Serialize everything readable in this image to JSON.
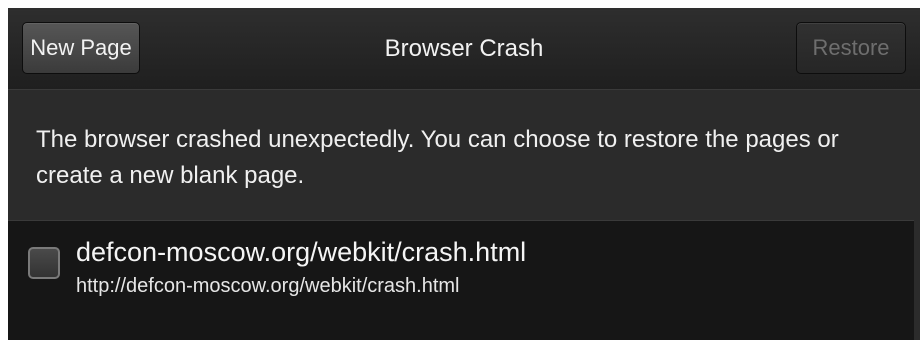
{
  "titlebar": {
    "title": "Browser Crash",
    "new_page_label": "New Page",
    "restore_label": "Restore",
    "restore_enabled": false
  },
  "message": "The browser crashed unexpectedly. You can choose to restore the pages or create a new blank page.",
  "pages": [
    {
      "title": "defcon-moscow.org/webkit/crash.html",
      "url": "http://defcon-moscow.org/webkit/crash.html",
      "checked": false
    }
  ],
  "colors": {
    "background": "#2b2b2b",
    "list_background": "#161616",
    "text": "#f0f0f0",
    "disabled_text": "#6e6e6e"
  }
}
